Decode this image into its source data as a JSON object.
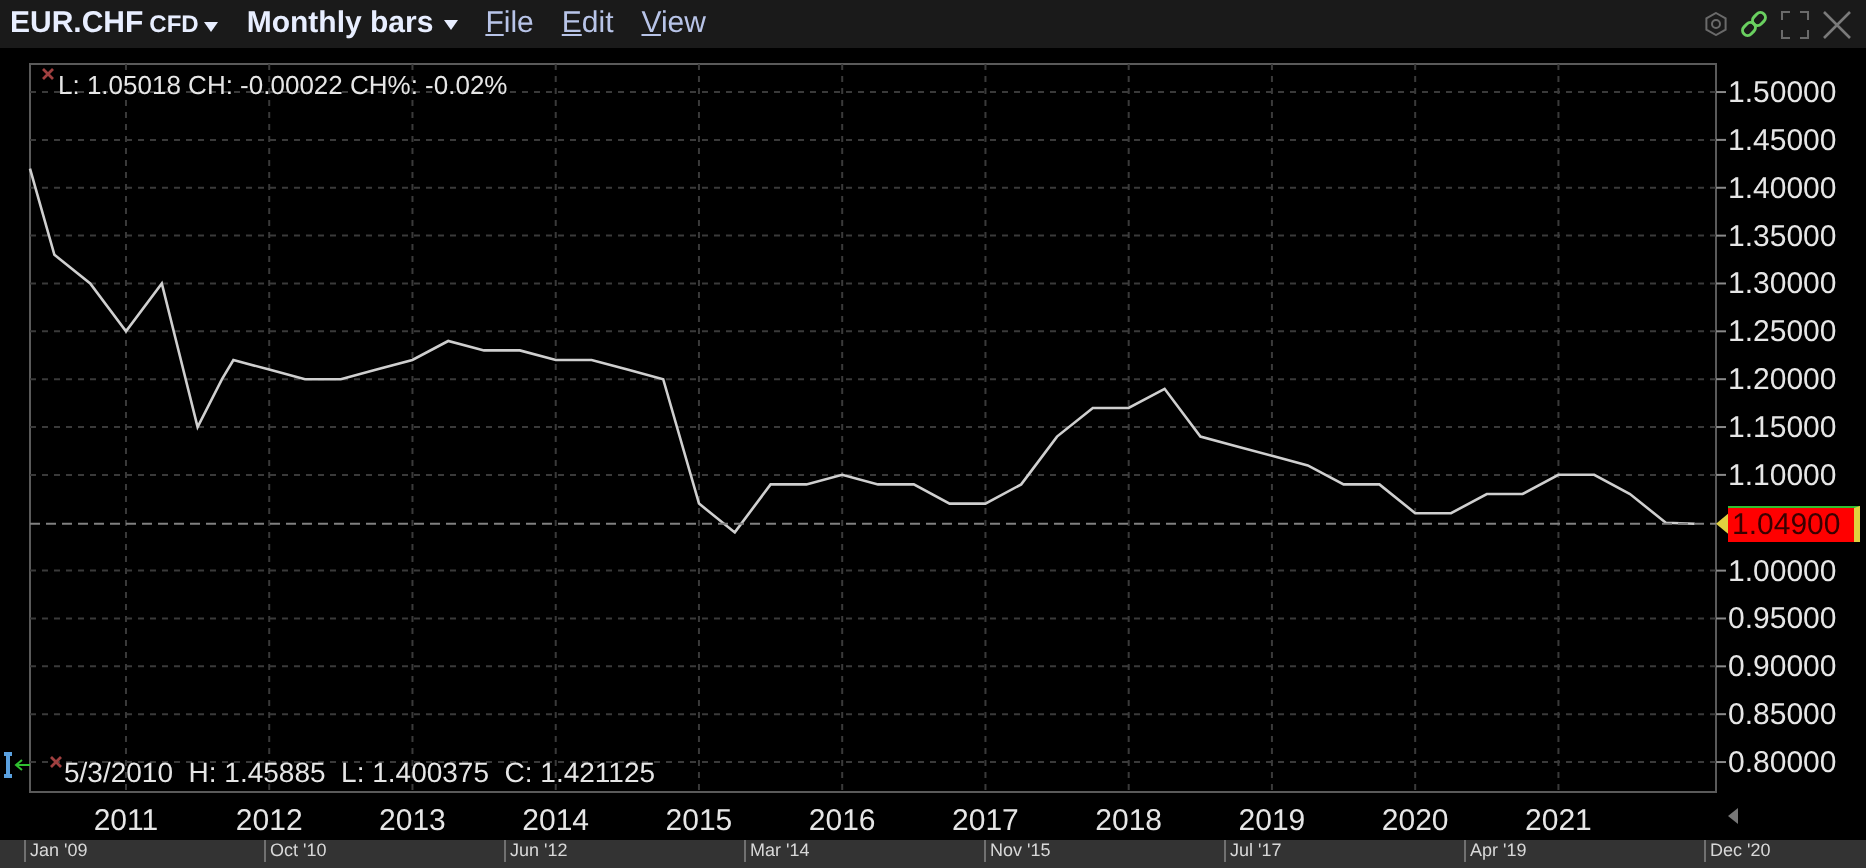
{
  "toolbar": {
    "symbol": "EUR.CHF",
    "instrument_type": "CFD",
    "period": "Monthly bars",
    "menus": [
      "File",
      "Edit",
      "View"
    ]
  },
  "chart": {
    "info_top": "L: 1.05018 CH: -0.00022 CH%: -0.02%",
    "info_bottom": "5/3/2010  H: 1.45885  L: 1.400375  C: 1.421125",
    "last_price": "1.04900",
    "chart_data": {
      "type": "line",
      "x": [
        2010.33,
        2010.5,
        2010.75,
        2011.0,
        2011.25,
        2011.5,
        2011.67,
        2011.75,
        2012.0,
        2012.25,
        2012.5,
        2012.75,
        2013.0,
        2013.25,
        2013.5,
        2013.75,
        2014.0,
        2014.25,
        2014.5,
        2014.75,
        2015.0,
        2015.25,
        2015.5,
        2015.75,
        2016.0,
        2016.25,
        2016.5,
        2016.75,
        2017.0,
        2017.25,
        2017.5,
        2017.75,
        2018.0,
        2018.25,
        2018.5,
        2018.75,
        2019.0,
        2019.25,
        2019.5,
        2019.75,
        2020.0,
        2020.25,
        2020.5,
        2020.75,
        2021.0,
        2021.25,
        2021.5,
        2021.75,
        2021.95,
        2022.1
      ],
      "series": [
        {
          "color": "#cfcfcf",
          "values": [
            1.42,
            1.33,
            1.3,
            1.25,
            1.3,
            1.15,
            1.2,
            1.22,
            1.21,
            1.2,
            1.2,
            1.21,
            1.22,
            1.24,
            1.23,
            1.23,
            1.22,
            1.22,
            1.21,
            1.2,
            1.07,
            1.04,
            1.09,
            1.09,
            1.1,
            1.09,
            1.09,
            1.07,
            1.07,
            1.09,
            1.14,
            1.17,
            1.17,
            1.19,
            1.14,
            1.13,
            1.12,
            1.11,
            1.09,
            1.09,
            1.06,
            1.06,
            1.08,
            1.08,
            1.1,
            1.1,
            1.08,
            1.05,
            1.049,
            null
          ]
        },
        {
          "color": "#808080",
          "line_style": "dashed",
          "values": [
            1.049,
            1.049,
            1.049,
            1.049,
            1.049,
            1.049,
            1.049,
            1.049,
            1.049,
            1.049,
            1.049,
            1.049,
            1.049,
            1.049,
            1.049,
            1.049,
            1.049,
            1.049,
            1.049,
            1.049,
            1.049,
            1.049,
            1.049,
            1.049,
            1.049,
            1.049,
            1.049,
            1.049,
            1.049,
            1.049,
            1.049,
            1.049,
            1.049,
            1.049,
            1.049,
            1.049,
            1.049,
            1.049,
            1.049,
            1.049,
            1.049,
            1.049,
            1.049,
            1.049,
            1.049,
            1.049,
            1.049,
            1.049,
            1.049,
            1.049
          ]
        }
      ],
      "xlim": [
        2010.33,
        2022.1
      ],
      "ylim": [
        0.7687,
        1.5293
      ],
      "grid": true,
      "xticks": [
        2011,
        2012,
        2013,
        2014,
        2015,
        2016,
        2017,
        2018,
        2019,
        2020,
        2021
      ],
      "yticks": [
        {
          "value": 1.5,
          "label": "1.50000"
        },
        {
          "value": 1.45,
          "label": "1.45000"
        },
        {
          "value": 1.4,
          "label": "1.40000"
        },
        {
          "value": 1.35,
          "label": "1.35000"
        },
        {
          "value": 1.3,
          "label": "1.30000"
        },
        {
          "value": 1.25,
          "label": "1.25000"
        },
        {
          "value": 1.2,
          "label": "1.20000"
        },
        {
          "value": 1.15,
          "label": "1.15000"
        },
        {
          "value": 1.1,
          "label": "1.10000"
        },
        {
          "value": 1.0,
          "label": "1.00000"
        },
        {
          "value": 0.95,
          "label": "0.95000"
        },
        {
          "value": 0.9,
          "label": "0.90000"
        },
        {
          "value": 0.85,
          "label": "0.85000"
        },
        {
          "value": 0.8,
          "label": "0.80000"
        }
      ]
    }
  },
  "navigator": {
    "labels": [
      "Jan '09",
      "Oct '10",
      "Jun '12",
      "Mar '14",
      "Nov '15",
      "Jul '17",
      "Apr '19",
      "Dec '20"
    ]
  }
}
